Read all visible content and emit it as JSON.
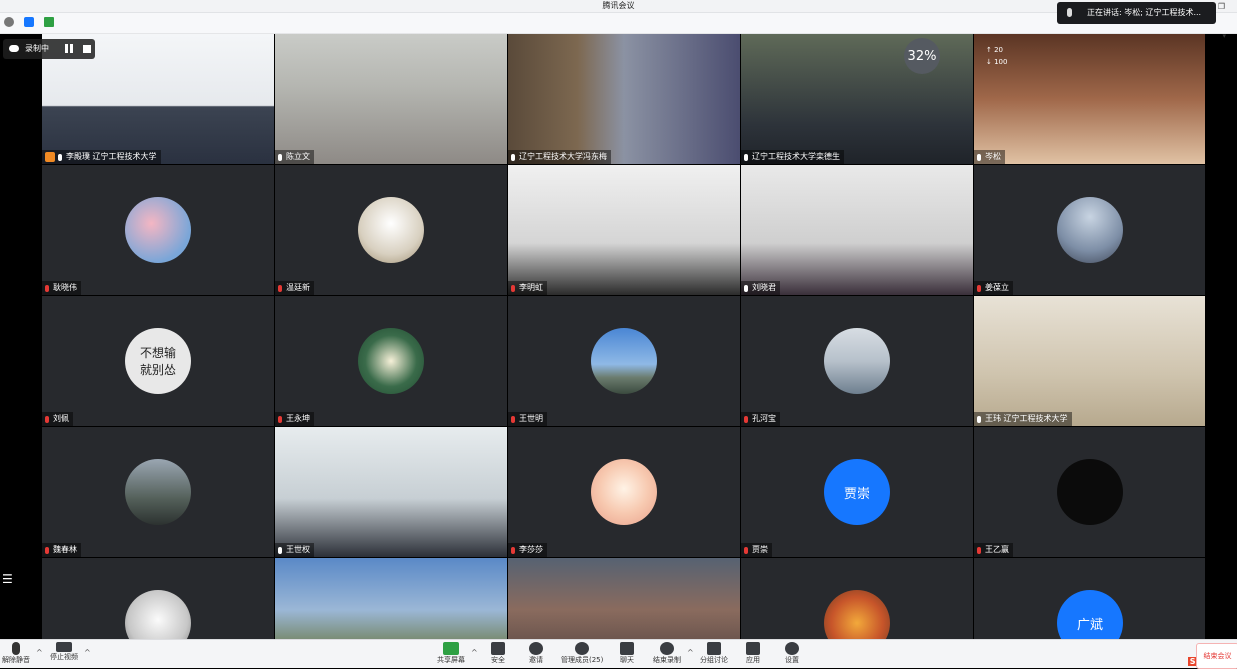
{
  "window": {
    "title": "腾讯会议",
    "restore_icon": "restore-icon"
  },
  "topbar": {
    "icons": [
      "info-icon",
      "shield-icon",
      "signal-icon"
    ]
  },
  "speaking": {
    "text": "正在讲话: 岑松; 辽宁工程技术..."
  },
  "recording": {
    "label": "录制中"
  },
  "network": {
    "percent": "32%",
    "up": "20",
    "down": "100"
  },
  "tiles": [
    {
      "name": "李殿璞 辽宁工程技术大学",
      "type": "video",
      "host": true,
      "muted": false
    },
    {
      "name": "陈立文",
      "type": "video",
      "muted": false
    },
    {
      "name": "辽宁工程技术大学冯东梅",
      "type": "video",
      "muted": false
    },
    {
      "name": "辽宁工程技术大学栾德生",
      "type": "video",
      "muted": false
    },
    {
      "name": "岑松",
      "type": "video",
      "muted": false,
      "speaker": true
    },
    {
      "name": "耿晓伟",
      "type": "avatar",
      "muted": true,
      "avatar": "flowers"
    },
    {
      "name": "温廷新",
      "type": "avatar",
      "muted": true,
      "avatar": "dog"
    },
    {
      "name": "李明虹",
      "type": "video",
      "muted": true
    },
    {
      "name": "刘晓君",
      "type": "video",
      "muted": false
    },
    {
      "name": "姜葆立",
      "type": "avatar",
      "muted": true,
      "avatar": "mountain"
    },
    {
      "name": "刘佩",
      "type": "avatar",
      "muted": true,
      "avatar": "calligraphy",
      "calligraphy": [
        "不想输",
        "就别怂"
      ]
    },
    {
      "name": "王永坤",
      "type": "avatar",
      "muted": true,
      "avatar": "lily"
    },
    {
      "name": "王世明",
      "type": "avatar",
      "muted": true,
      "avatar": "city"
    },
    {
      "name": "孔河宝",
      "type": "avatar",
      "muted": true,
      "avatar": "pier"
    },
    {
      "name": "王玮 辽宁工程技术大学",
      "type": "video",
      "muted": false
    },
    {
      "name": "魏春林",
      "type": "avatar",
      "muted": true,
      "avatar": "person"
    },
    {
      "name": "王世权",
      "type": "video",
      "muted": false
    },
    {
      "name": "李莎莎",
      "type": "avatar",
      "muted": true,
      "avatar": "cartoon"
    },
    {
      "name": "贾崇",
      "type": "text-avatar",
      "muted": true,
      "initials": "贾崇"
    },
    {
      "name": "王乙赢",
      "type": "avatar",
      "muted": true,
      "avatar": "cats"
    },
    {
      "name": "",
      "type": "avatar",
      "avatar": "baby"
    },
    {
      "name": "",
      "type": "video"
    },
    {
      "name": "",
      "type": "video"
    },
    {
      "name": "",
      "type": "avatar",
      "avatar": "leaves"
    },
    {
      "name": "",
      "type": "text-avatar",
      "initials": "广斌"
    }
  ],
  "toolbar": {
    "unmute": "解除静音",
    "stop_video": "停止视频",
    "share": "共享屏幕",
    "security": "安全",
    "invite": "邀请",
    "members": "管理成员(25)",
    "chat": "聊天",
    "end_record": "结束录制",
    "breakout": "分组讨论",
    "apps": "应用",
    "settings": "设置",
    "end_meeting": "结束会议"
  },
  "ime": {
    "brand": "S",
    "lang": "中"
  },
  "colors": {
    "accent": "#1677ff",
    "speaker_border": "#2ea043",
    "muted": "#e53935",
    "tile_bg": "#27292d"
  }
}
